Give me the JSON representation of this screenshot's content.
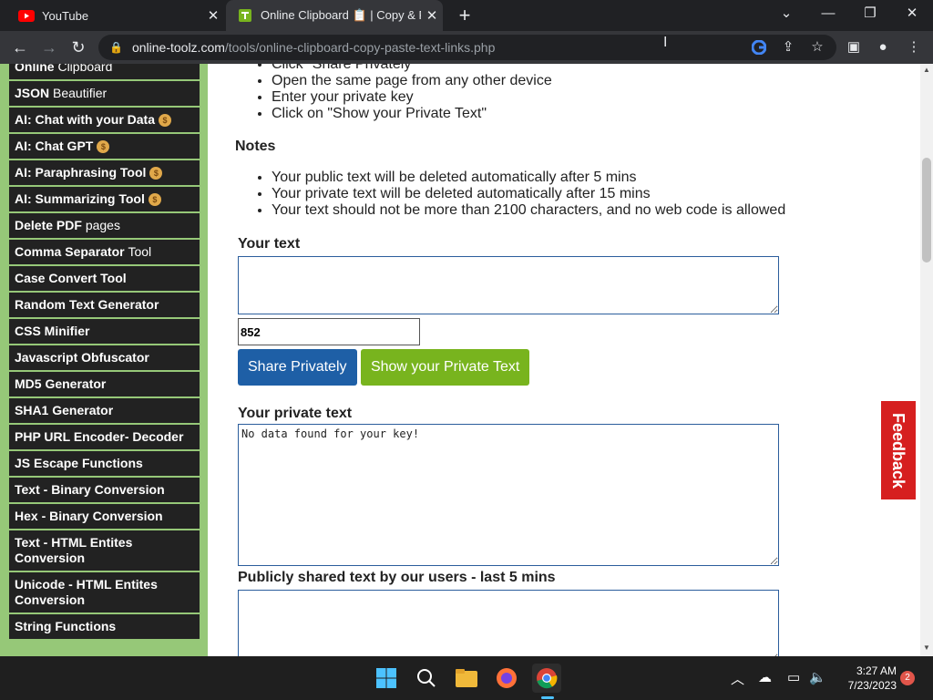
{
  "browser": {
    "tabs": [
      {
        "title": "YouTube",
        "active": false
      },
      {
        "title": "Online Clipboard 📋 | Copy & Pa",
        "active": true
      }
    ],
    "url_host": "online-toolz.com",
    "url_path": "/tools/online-clipboard-copy-paste-text-links.php"
  },
  "sidebar": {
    "items": [
      {
        "bold": "Online ",
        "normal": "Clipboard",
        "bag": false
      },
      {
        "bold": "JSON ",
        "normal": "Beautifier",
        "bag": false
      },
      {
        "bold": "AI: Chat with your Data",
        "normal": "",
        "bag": true
      },
      {
        "bold": "AI: Chat GPT",
        "normal": "",
        "bag": true
      },
      {
        "bold": "AI: Paraphrasing Tool",
        "normal": "",
        "bag": true
      },
      {
        "bold": "AI: Summarizing Tool",
        "normal": "",
        "bag": true
      },
      {
        "bold": "Delete PDF ",
        "normal": "pages",
        "bag": false
      },
      {
        "bold": "Comma Separator ",
        "normal": "Tool",
        "bag": false
      },
      {
        "bold": "Case Convert Tool",
        "normal": "",
        "bag": false
      },
      {
        "bold": "Random Text Generator",
        "normal": "",
        "bag": false
      },
      {
        "bold": "CSS Minifier",
        "normal": "",
        "bag": false
      },
      {
        "bold": "Javascript Obfuscator",
        "normal": "",
        "bag": false
      },
      {
        "bold": "MD5 Generator",
        "normal": "",
        "bag": false
      },
      {
        "bold": "SHA1 Generator",
        "normal": "",
        "bag": false
      },
      {
        "bold": "PHP URL Encoder- Decoder",
        "normal": "",
        "bag": false
      },
      {
        "bold": "JS Escape Functions",
        "normal": "",
        "bag": false
      },
      {
        "bold": "Text - Binary Conversion",
        "normal": "",
        "bag": false
      },
      {
        "bold": "Hex - Binary Conversion",
        "normal": "",
        "bag": false
      },
      {
        "bold": "Text - HTML Entites Conversion",
        "normal": "",
        "bag": false
      },
      {
        "bold": "Unicode - HTML Entites Conversion",
        "normal": "",
        "bag": false
      },
      {
        "bold": "String Functions",
        "normal": "",
        "bag": false
      }
    ]
  },
  "main": {
    "steps": [
      "Click \"Share Privately\"",
      "Open the same page from any other device",
      "Enter your private key",
      "Click on \"Show your Private Text\""
    ],
    "notes_heading": "Notes",
    "notes": [
      "Your public text will be deleted automatically after 5 mins",
      "Your private text will be deleted automatically after 15 mins",
      "Your text should not be more than 2100 characters, and no web code is allowed"
    ],
    "your_text_label": "Your text",
    "your_text_value": "",
    "key_value": "852",
    "share_button": "Share Privately",
    "show_button": "Show your Private Text",
    "private_text_label": "Your private text",
    "private_text_value": "No data found for your key!",
    "public_label": "Publicly shared text by our users - last 5 mins",
    "public_value": ""
  },
  "feedback_label": "Feedback",
  "taskbar": {
    "time": "3:27 AM",
    "date": "7/23/2023",
    "notification_count": "2"
  }
}
